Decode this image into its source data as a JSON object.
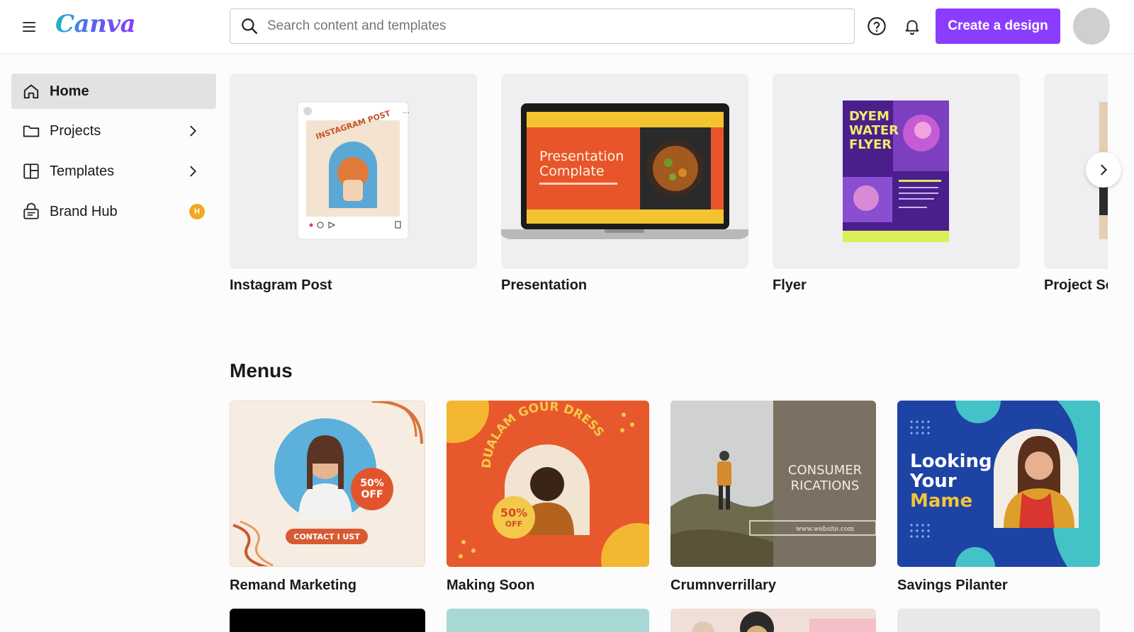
{
  "app": {
    "logo": "Canva"
  },
  "header": {
    "search_placeholder": "Search content and templates",
    "create_label": "Create a design"
  },
  "sidebar": {
    "items": [
      {
        "label": "Home",
        "icon": "home-icon",
        "active": true
      },
      {
        "label": "Projects",
        "icon": "folder-icon"
      },
      {
        "label": "Templates",
        "icon": "templates-icon"
      },
      {
        "label": "Brand Hub",
        "icon": "brand-hub-icon",
        "badge": "H"
      }
    ]
  },
  "design_types": [
    {
      "label": "Instagram Post",
      "thumb_text": "INSTAGRAM POST"
    },
    {
      "label": "Presentation",
      "thumb_title_1": "Presentation",
      "thumb_title_2": "Complate"
    },
    {
      "label": "Flyer",
      "thumb_text_1": "DYEM",
      "thumb_text_2": "WATER",
      "thumb_text_3": "FLYER"
    },
    {
      "label": "Project Sc"
    }
  ],
  "menus": {
    "title": "Menus",
    "items": [
      {
        "label": "Remand Marketing",
        "discount_1": "50%",
        "discount_2": "OFF",
        "cta": "CONTACT I UST"
      },
      {
        "label": "Making Soon",
        "arc_text": "DUALAM GOUR DRESS",
        "discount_1": "50%",
        "discount_2": "OFF"
      },
      {
        "label": "Crumnverrillary",
        "line1": "CONSUMER",
        "line2": "RICATIONS",
        "website": "www.website.com"
      },
      {
        "label": "Savings Pilanter",
        "line1": "Looking",
        "line2": "Your",
        "line3": "Mame"
      }
    ]
  },
  "colors": {
    "brand_purple": "#8b3dff",
    "active_bg": "#e2e2e4",
    "badge": "#f5a623"
  }
}
